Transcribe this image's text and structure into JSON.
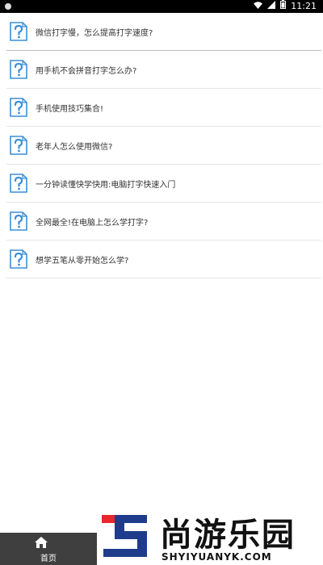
{
  "status_bar": {
    "time": "11:21",
    "icons": [
      "notification-dot-icon",
      "wifi-icon",
      "signal-icon",
      "battery-icon"
    ]
  },
  "list": {
    "items": [
      {
        "label": "微信打字慢，怎么提高打字速度?",
        "icon": "question-document-icon"
      },
      {
        "label": "用手机不会拼音打字怎么办?",
        "icon": "question-document-icon"
      },
      {
        "label": "手机使用技巧集合!",
        "icon": "question-document-icon"
      },
      {
        "label": "老年人怎么使用微信?",
        "icon": "question-document-icon"
      },
      {
        "label": "一分钟读懂快学快用:电脑打字快速入门",
        "icon": "question-document-icon"
      },
      {
        "label": "全网最全!在电脑上怎么学打字?",
        "icon": "question-document-icon"
      },
      {
        "label": "想学五笔从零开始怎么学?",
        "icon": "question-document-icon"
      }
    ]
  },
  "bottom_nav": {
    "home_label": "首页",
    "home_icon": "home-icon"
  },
  "watermark": {
    "brand_cn": "尚游乐园",
    "brand_en": "SHYIYUANYK.COM"
  },
  "colors": {
    "icon_blue": "#3b8fd6",
    "status_bar_bg": "#000000",
    "nav_bg": "#3f3f3f",
    "logo_red": "#e8262c",
    "logo_blue": "#1f3c8c"
  }
}
